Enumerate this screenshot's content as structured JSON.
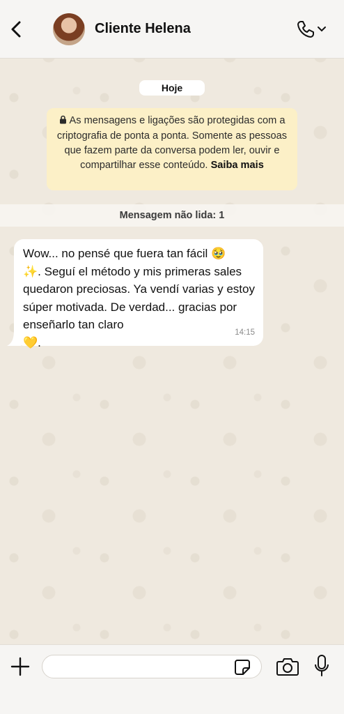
{
  "header": {
    "contact_name": "Cliente Helena",
    "back_icon": "chevron-left-icon",
    "call_icon": "phone-icon",
    "call_dropdown_icon": "chevron-down-icon"
  },
  "chat": {
    "date_chip": "Hoje",
    "encryption_notice": {
      "text": "As mensagens e ligações são protegidas com a criptografia de ponta a ponta. Somente as pessoas que fazem parte da conversa podem ler, ouvir e compartilhar esse conteúdo.",
      "link": "Saiba mais",
      "icon": "lock-icon"
    },
    "unread_label": "Mensagem não lida: 1",
    "messages": [
      {
        "direction": "incoming",
        "text_part1": "Wow... no pensé que fuera tan fácil 🥹",
        "text_part2": "✨. Seguí el método y mis primeras sales quedaron preciosas. Ya vendí varias y estoy súper motivada. De verdad... gracias por enseñarlo tan claro",
        "text_part3": "💛.",
        "time": "14:15"
      }
    ]
  },
  "composer": {
    "input_value": "",
    "input_placeholder": "",
    "icons": [
      "plus-icon",
      "sticker-icon",
      "camera-icon",
      "mic-icon"
    ]
  },
  "colors": {
    "header_bg": "#f6f5f3",
    "wallpaper": "#efe9df",
    "notice_bg": "#fcf0c7",
    "bubble_bg": "#ffffff"
  }
}
